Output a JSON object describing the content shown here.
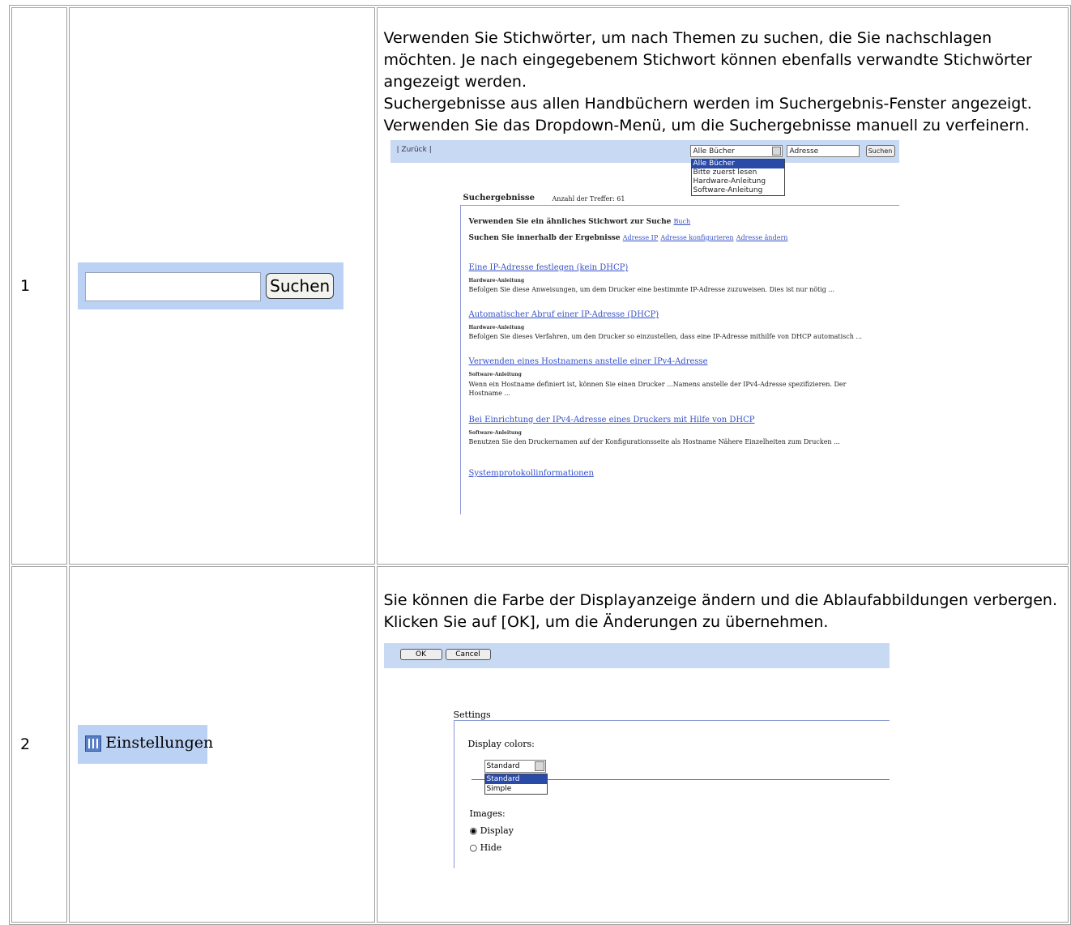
{
  "rows": [
    {
      "number": "1",
      "control": {
        "button_label": "Suchen"
      },
      "description": [
        "Verwenden Sie Stichwörter, um nach Themen zu suchen, die Sie nachschlagen möchten. Je nach eingegebenem Stichwort können ebenfalls verwandte Stichwörter angezeigt werden.",
        "Suchergebnisse aus allen Handbüchern werden im Suchergebnis-Fenster angezeigt. Verwenden Sie das Dropdown-Menü, um die Suchergebnisse manuell zu verfeinern."
      ],
      "screenshot": {
        "back_label": "| Zurück |",
        "combo_value": "Alle Bücher",
        "dropdown_options": [
          "Alle Bücher",
          "Bitte zuerst lesen",
          "Hardware-Anleitung",
          "Software-Anleitung"
        ],
        "keyword_value": "Adresse",
        "search_button": "Suchen",
        "results_title": "Suchergebnisse",
        "hits_label": "Anzahl der Treffer:  61",
        "similar_label": "Verwenden Sie ein ähnliches Stichwort zur Suche",
        "similar_link": "Buch",
        "refine_label": "Suchen Sie innerhalb der Ergebnisse",
        "refine_links": [
          "Adresse IP",
          "Adresse konfigurieren",
          "Adresse ändern"
        ],
        "results": [
          {
            "title": "Eine IP-Adresse festlegen (kein DHCP)",
            "source": "Hardware-Anleitung",
            "snippet": "Befolgen Sie diese Anweisungen, um dem Drucker eine bestimmte IP-Adresse zuzuweisen. Dies ist nur nötig ..."
          },
          {
            "title": "Automatischer Abruf einer IP-Adresse (DHCP)",
            "source": "Hardware-Anleitung",
            "snippet": "Befolgen Sie dieses Verfahren, um den Drucker so einzustellen, dass eine IP-Adresse mithilfe von DHCP automatisch ..."
          },
          {
            "title": "Verwenden eines Hostnamens anstelle einer IPv4-Adresse",
            "source": "Software-Anleitung",
            "snippet": "Wenn ein Hostname definiert ist, können Sie einen Drucker ...Namens anstelle der IPv4-Adresse spezifizieren. Der Hostname ..."
          },
          {
            "title": "Bei Einrichtung der IPv4-Adresse eines Druckers mit Hilfe von DHCP",
            "source": "Software-Anleitung",
            "snippet": "Benutzen Sie den Druckernamen auf der Konfigurationsseite als Hostname Nähere Einzelheiten zum Drucken ..."
          },
          {
            "title": "Systemprotokollinformationen",
            "source": "",
            "snippet": ""
          }
        ]
      }
    },
    {
      "number": "2",
      "control": {
        "label": "Einstellungen"
      },
      "description": [
        "Sie können die Farbe der Displayanzeige ändern und die Ablaufabbildungen verbergen.",
        "Klicken Sie auf [OK], um die Änderungen zu übernehmen."
      ],
      "screenshot": {
        "ok_button": "OK",
        "cancel_button": "Cancel",
        "settings_title": "Settings",
        "display_colors_label": "Display colors:",
        "select_value": "Standard",
        "options": [
          "Standard",
          "Simple"
        ],
        "images_label": "Images:",
        "radio_display": "Display",
        "radio_hide": "Hide"
      }
    }
  ]
}
